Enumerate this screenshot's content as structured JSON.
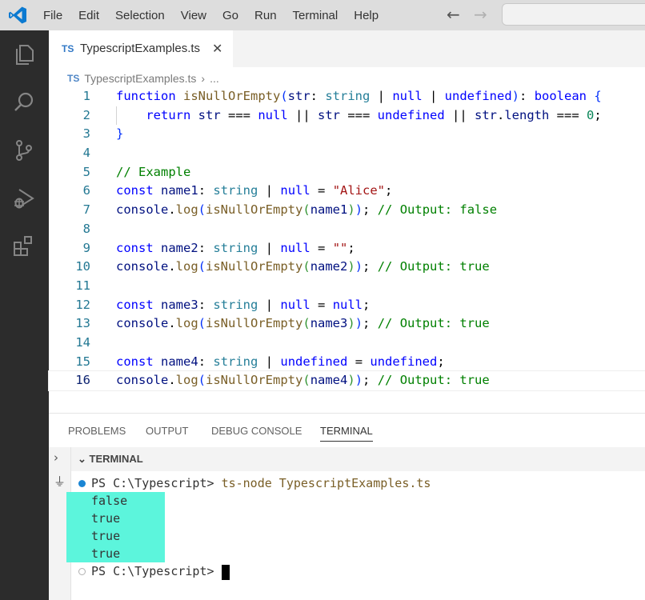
{
  "menu": [
    "File",
    "Edit",
    "Selection",
    "View",
    "Go",
    "Run",
    "Terminal",
    "Help"
  ],
  "navigation": {
    "back_icon": "arrow-left-icon",
    "forward_icon": "arrow-right-icon"
  },
  "activity_bar": [
    "explorer-icon",
    "search-icon",
    "source-control-icon",
    "run-debug-icon",
    "extensions-icon"
  ],
  "tab": {
    "language_badge": "TS",
    "title": "TypescriptExamples.ts",
    "close_icon": "close-icon"
  },
  "breadcrumb": {
    "language_badge": "TS",
    "file": "TypescriptExamples.ts",
    "separator": "›",
    "rest": "..."
  },
  "editor": {
    "line_numbers": [
      "1",
      "2",
      "3",
      "4",
      "5",
      "6",
      "7",
      "8",
      "9",
      "10",
      "11",
      "12",
      "13",
      "14",
      "15",
      "16"
    ],
    "current_line": 16,
    "lines": [
      "function isNullOrEmpty(str: string | null | undefined): boolean {",
      "    return str === null || str === undefined || str.length === 0;",
      "}",
      "",
      "// Example",
      "const name1: string | null = \"Alice\";",
      "console.log(isNullOrEmpty(name1)); // Output: false",
      "",
      "const name2: string | null = \"\";",
      "console.log(isNullOrEmpty(name2)); // Output: true",
      "",
      "const name3: string | null = null;",
      "console.log(isNullOrEmpty(name3)); // Output: true",
      "",
      "const name4: string | undefined = undefined;",
      "console.log(isNullOrEmpty(name4)); // Output: true"
    ]
  },
  "panel": {
    "tabs": [
      "PROBLEMS",
      "OUTPUT",
      "DEBUG CONSOLE",
      "TERMINAL"
    ],
    "active_tab": "TERMINAL",
    "terminal_title": "TERMINAL",
    "prompt": "PS C:\\Typescript>",
    "command": "ts-node TypescriptExamples.ts",
    "output": [
      "false",
      "true",
      "true",
      "true"
    ],
    "highlight_color": "#5cf5dc"
  },
  "colors": {
    "activity_bar": "#2c2c2c",
    "accent": "#0066b8",
    "keyword": "#0000ff",
    "type": "#267f99",
    "comment": "#008000"
  }
}
